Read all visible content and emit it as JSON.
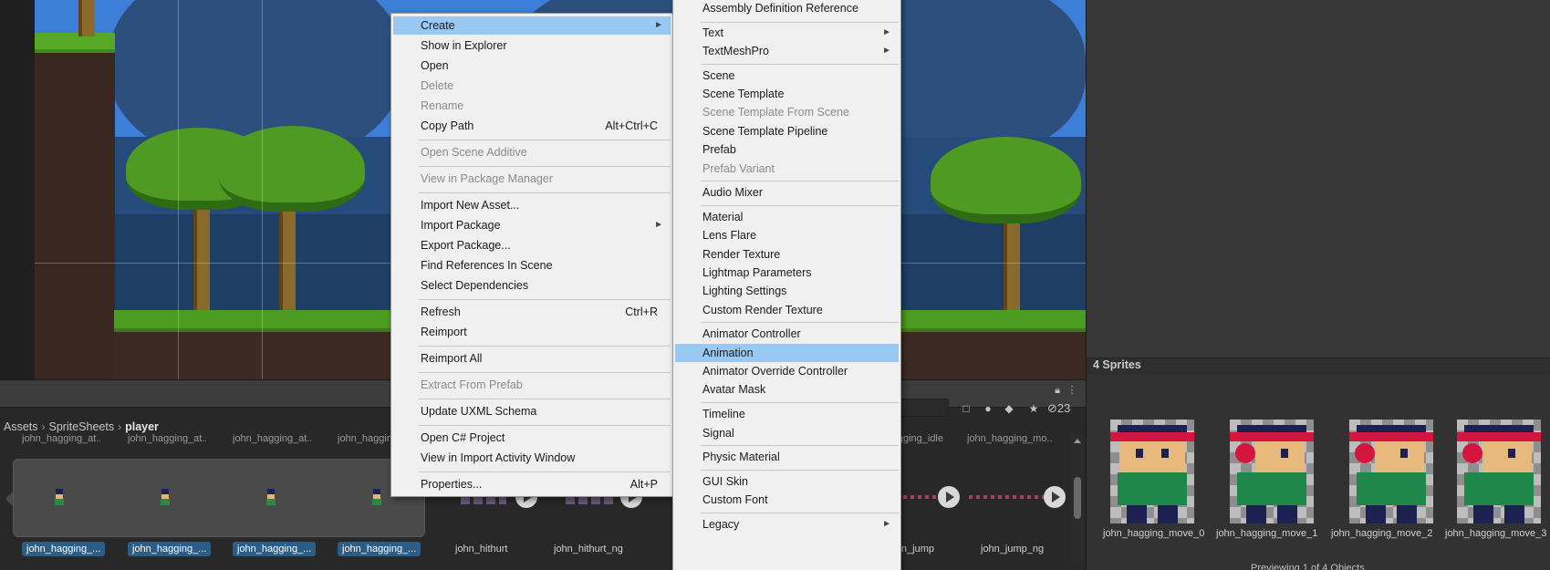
{
  "colors": {
    "menu_bg": "#f0f0f0",
    "menu_highlight": "#99c9f2",
    "menu_disabled_text": "#8b8b8b",
    "selection_blue": "#2c5d87",
    "panel_bg": "#282828",
    "inspector_bg": "#383838"
  },
  "project": {
    "breadcrumb": [
      "Assets",
      "SpriteSheets",
      "player"
    ],
    "hidden_count": "23",
    "row_labels": [
      "john_hagging_at...",
      "john_hagging_at...",
      "john_hagging_at...",
      "john_hagging_at...",
      "john_hagging_idle",
      "john_hagging_mo..."
    ],
    "items": [
      {
        "label": "john_hagging_...",
        "selected": true
      },
      {
        "label": "john_hagging_...",
        "selected": true
      },
      {
        "label": "john_hagging_...",
        "selected": true
      },
      {
        "label": "john_hagging_...",
        "selected": true
      },
      {
        "label": "john_hithurt",
        "selected": false
      },
      {
        "label": "john_hithurt_ng",
        "selected": false
      },
      {
        "label": "john_jump",
        "selected": false
      },
      {
        "label": "john_jump_ng",
        "selected": false
      }
    ],
    "toolbar_icons": [
      "lock-icon",
      "kebab-menu-icon",
      "search-by-type-icon",
      "filter-by-label-icon",
      "tag-icon",
      "star-icon",
      "eye-hidden-icon"
    ]
  },
  "context_menu": {
    "items": [
      {
        "label": "Create",
        "submenu": true,
        "highlighted": true
      },
      {
        "label": "Show in Explorer"
      },
      {
        "label": "Open"
      },
      {
        "label": "Delete",
        "disabled": true
      },
      {
        "label": "Rename",
        "disabled": true
      },
      {
        "label": "Copy Path",
        "shortcut": "Alt+Ctrl+C"
      },
      {
        "label": "Open Scene Additive",
        "disabled": true,
        "separator_before": true
      },
      {
        "label": "View in Package Manager",
        "disabled": true,
        "separator_before": true
      },
      {
        "label": "Import New Asset...",
        "separator_before": true
      },
      {
        "label": "Import Package",
        "submenu": true
      },
      {
        "label": "Export Package..."
      },
      {
        "label": "Find References In Scene"
      },
      {
        "label": "Select Dependencies"
      },
      {
        "label": "Refresh",
        "shortcut": "Ctrl+R",
        "separator_before": true
      },
      {
        "label": "Reimport"
      },
      {
        "label": "Reimport All",
        "separator_before": true
      },
      {
        "label": "Extract From Prefab",
        "disabled": true,
        "separator_before": true
      },
      {
        "label": "Update UXML Schema",
        "separator_before": true
      },
      {
        "label": "Open C# Project",
        "separator_before": true
      },
      {
        "label": "View in Import Activity Window"
      },
      {
        "label": "Properties...",
        "shortcut": "Alt+P",
        "separator_before": true
      }
    ]
  },
  "create_submenu": {
    "items": [
      {
        "label": "Assembly Definition Reference"
      },
      {
        "label": "Text",
        "submenu": true,
        "separator_before": true
      },
      {
        "label": "TextMeshPro",
        "submenu": true
      },
      {
        "label": "Scene",
        "separator_before": true
      },
      {
        "label": "Scene Template"
      },
      {
        "label": "Scene Template From Scene",
        "disabled": true
      },
      {
        "label": "Scene Template Pipeline"
      },
      {
        "label": "Prefab"
      },
      {
        "label": "Prefab Variant",
        "disabled": true
      },
      {
        "label": "Audio Mixer",
        "separator_before": true
      },
      {
        "label": "Material",
        "separator_before": true
      },
      {
        "label": "Lens Flare"
      },
      {
        "label": "Render Texture"
      },
      {
        "label": "Lightmap Parameters"
      },
      {
        "label": "Lighting Settings"
      },
      {
        "label": "Custom Render Texture"
      },
      {
        "label": "Animator Controller",
        "separator_before": true
      },
      {
        "label": "Animation",
        "highlighted": true
      },
      {
        "label": "Animator Override Controller"
      },
      {
        "label": "Avatar Mask"
      },
      {
        "label": "Timeline",
        "separator_before": true
      },
      {
        "label": "Signal"
      },
      {
        "label": "Physic Material",
        "separator_before": true
      },
      {
        "label": "GUI Skin",
        "separator_before": true
      },
      {
        "label": "Custom Font"
      },
      {
        "label": "Legacy",
        "submenu": true,
        "separator_before": true
      }
    ]
  },
  "inspector": {
    "title": "4 Sprites",
    "sprites": [
      "john_hagging_move_0",
      "john_hagging_move_1",
      "john_hagging_move_2",
      "john_hagging_move_3"
    ],
    "footer": "Previewing 1 of 4 Objects"
  }
}
